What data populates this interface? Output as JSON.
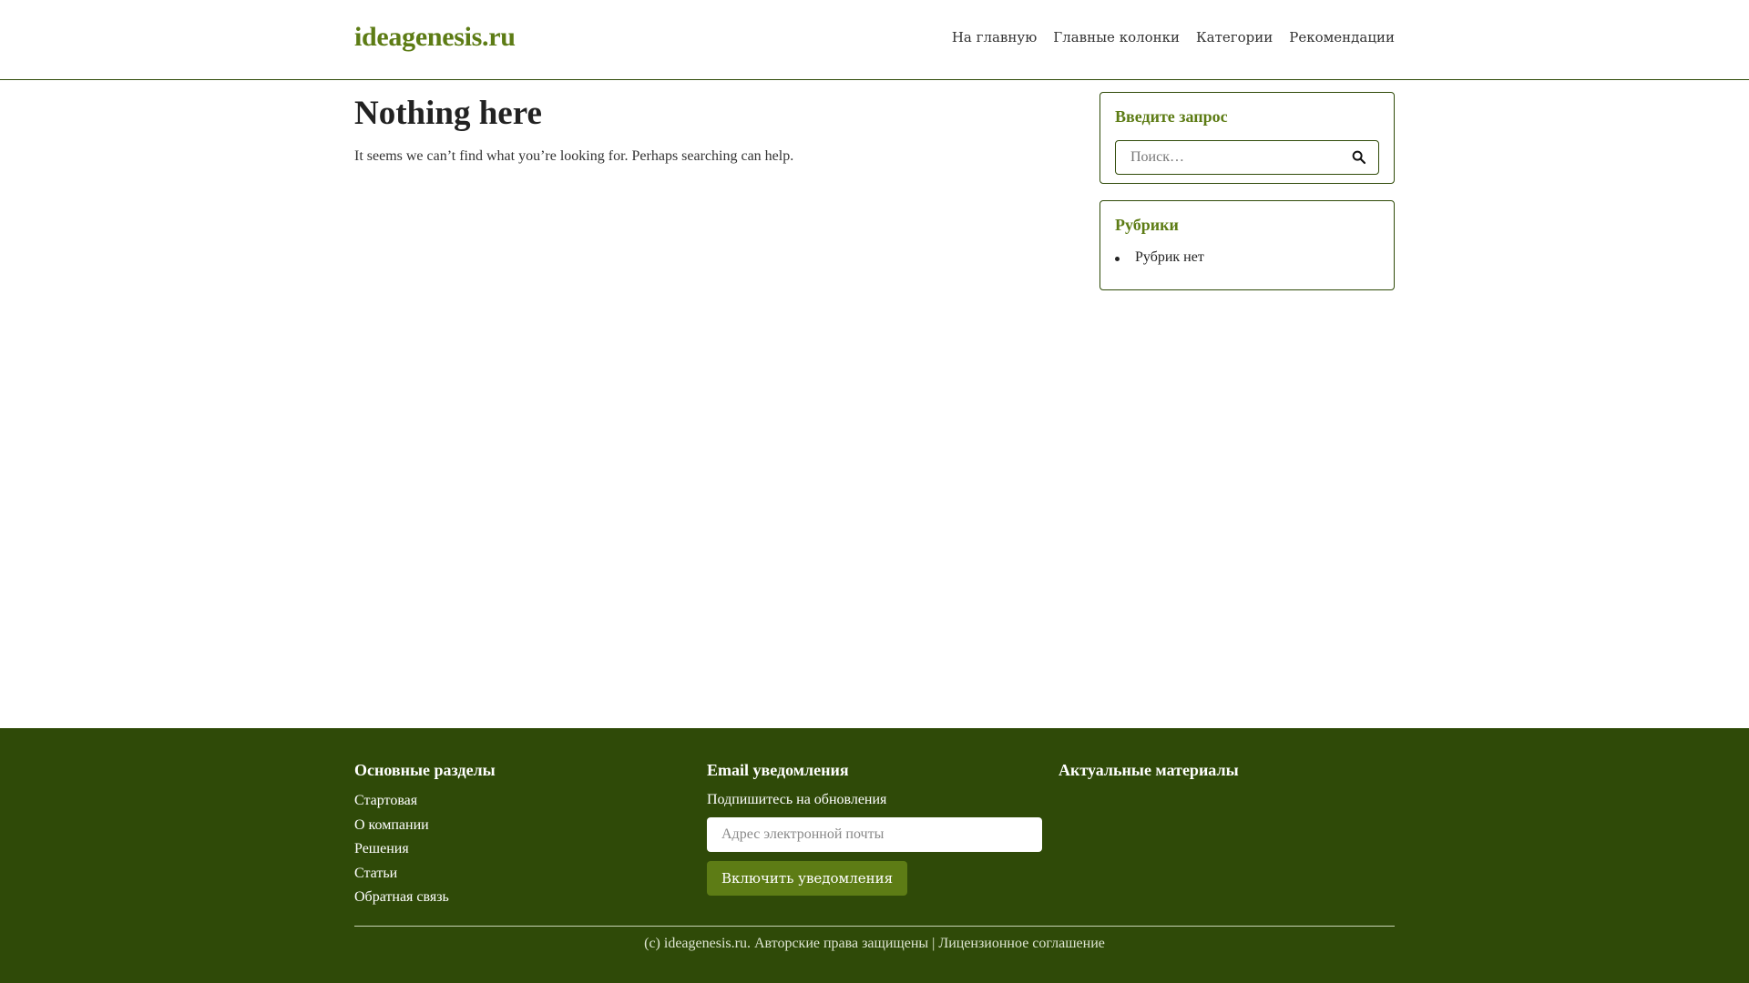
{
  "header": {
    "site_title": "ideagenesis.ru",
    "nav": [
      "На главную",
      "Главные колонки",
      "Категории",
      "Рекомендации"
    ]
  },
  "main": {
    "title": "Nothing here",
    "text": "It seems we can’t find what you’re looking for. Perhaps searching can help."
  },
  "sidebar": {
    "search": {
      "title": "Введите запрос",
      "placeholder": "Поиск…",
      "button_icon": "search-icon"
    },
    "categories": {
      "title": "Рубрики",
      "items": [
        "Рубрик нет"
      ]
    }
  },
  "footer": {
    "sections": {
      "title": "Основные разделы",
      "links": [
        "Стартовая",
        "О компании",
        "Решения",
        "Статьи",
        "Обратная связь"
      ]
    },
    "subscribe": {
      "title": "Email уведомления",
      "subtitle": "Подпишитесь на обновления",
      "email_placeholder": "Адрес электронной почты",
      "button_label": "Включить уведомления"
    },
    "recent": {
      "title": "Актуальные материалы"
    },
    "copyright": "(c) ideagenesis.ru. Авторские права защищены | Лицензионное соглашение"
  },
  "colors": {
    "accent": "#5d7c15",
    "footer_bg": "#2f4a08",
    "border": "#2f4a08"
  }
}
